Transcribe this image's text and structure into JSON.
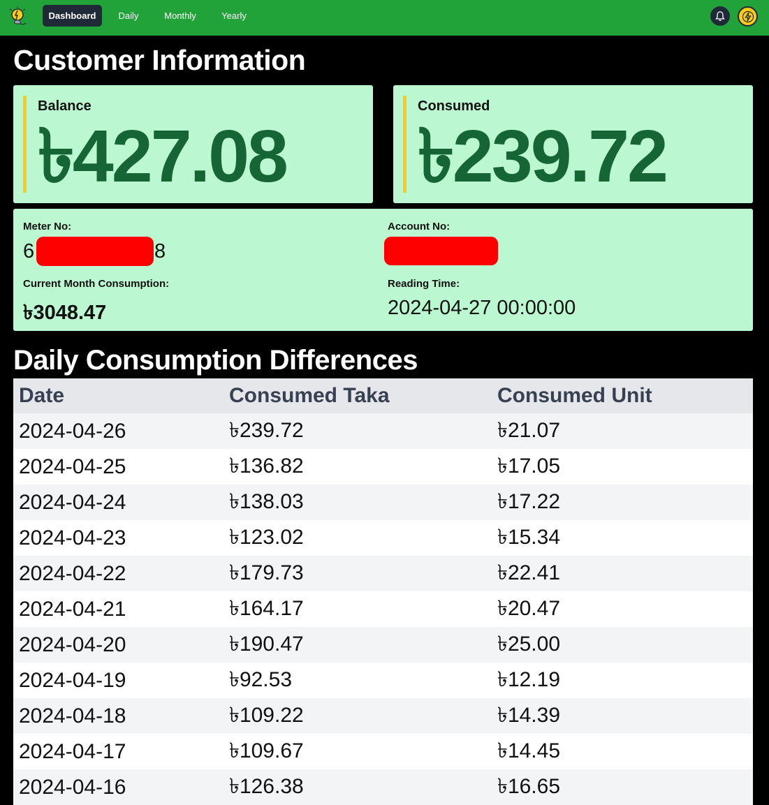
{
  "nav": {
    "tabs": [
      {
        "label": "Dashboard",
        "active": true
      },
      {
        "label": "Daily",
        "active": false
      },
      {
        "label": "Monthly",
        "active": false
      },
      {
        "label": "Yearly",
        "active": false
      }
    ],
    "icons": [
      "lightbulb-logo-icon",
      "bell-icon",
      "lightning-icon"
    ]
  },
  "customer": {
    "title": "Customer Information",
    "balance": {
      "label": "Balance",
      "value": "৳427.08"
    },
    "consumed": {
      "label": "Consumed",
      "value": "৳239.72"
    },
    "meter": {
      "label": "Meter No:",
      "prefix": "6",
      "suffix": "8"
    },
    "account": {
      "label": "Account No:"
    },
    "month_consumption": {
      "label": "Current Month Consumption:",
      "value": "৳3048.47"
    },
    "reading_time": {
      "label": "Reading Time:",
      "value": "2024-04-27 00:00:00"
    }
  },
  "daily": {
    "title": "Daily Consumption Differences",
    "columns": [
      "Date",
      "Consumed Taka",
      "Consumed Unit"
    ],
    "rows": [
      [
        "2024-04-26",
        "৳239.72",
        "৳21.07"
      ],
      [
        "2024-04-25",
        "৳136.82",
        "৳17.05"
      ],
      [
        "2024-04-24",
        "৳138.03",
        "৳17.22"
      ],
      [
        "2024-04-23",
        "৳123.02",
        "৳15.34"
      ],
      [
        "2024-04-22",
        "৳179.73",
        "৳22.41"
      ],
      [
        "2024-04-21",
        "৳164.17",
        "৳20.47"
      ],
      [
        "2024-04-20",
        "৳190.47",
        "৳25.00"
      ],
      [
        "2024-04-19",
        "৳92.53",
        "৳12.19"
      ],
      [
        "2024-04-18",
        "৳109.22",
        "৳14.39"
      ],
      [
        "2024-04-17",
        "৳109.67",
        "৳14.45"
      ],
      [
        "2024-04-16",
        "৳126.38",
        "৳16.65"
      ]
    ]
  },
  "colors": {
    "nav_bg": "#22a33a",
    "card_bg": "#bbf7d0",
    "value_green": "#166534",
    "accent_bar": "#facc15",
    "redaction": "#ff0000"
  }
}
